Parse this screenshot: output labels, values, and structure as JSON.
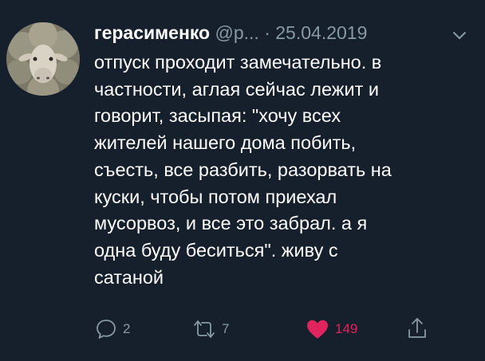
{
  "tweet": {
    "author_name": "герасименко",
    "handle": "@p...",
    "separator": "·",
    "date": "25.04.2019",
    "text": "отпуск проходит замечательно. в\nчастности, аглая сейчас лежит и\nговорит, засыпая: \"хочу всех\nжителей нашего дома побить,\nсъесть, все разбить, разорвать на\nкуски, чтобы потом приехал\nмусорвоз, и все это забрал. а я\nодна буду беситься\". живу с\nсатаной"
  },
  "actions": {
    "reply_count": "2",
    "retweet_count": "7",
    "like_count": "149"
  },
  "icons": {
    "reply": "speech-bubble-icon",
    "retweet": "retweet-icon",
    "like": "heart-icon",
    "share": "share-icon",
    "menu": "chevron-down-icon"
  },
  "colors": {
    "background": "#16202c",
    "secondary_text": "#8899a6",
    "like_active": "#e0245e"
  }
}
